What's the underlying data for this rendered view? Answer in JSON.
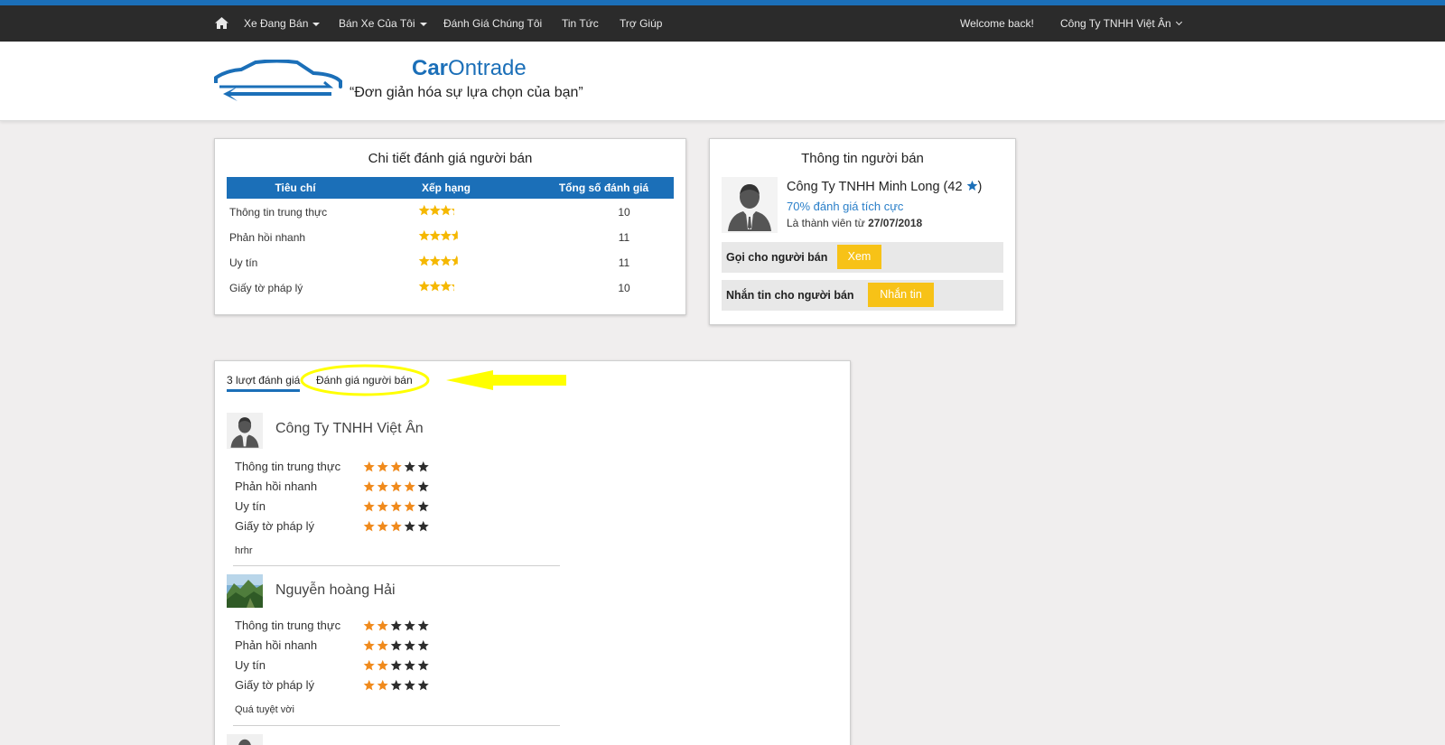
{
  "nav": {
    "items": [
      {
        "label": "Xe Đang Bán",
        "caret": true
      },
      {
        "label": "Bán Xe Của Tôi",
        "caret": true
      },
      {
        "label": "Đánh Giá Chúng Tôi",
        "caret": false
      },
      {
        "label": "Tin Tức",
        "caret": false
      },
      {
        "label": "Trợ Giúp",
        "caret": false
      }
    ],
    "welcome": "Welcome back!",
    "account": "Công Ty TNHH Việt Ân"
  },
  "header": {
    "brand_bold": "Car",
    "brand_rest": "Ontrade",
    "slogan": "“Đơn giản hóa sự lựa chọn của bạn”"
  },
  "ratings_panel": {
    "title": "Chi tiết đánh giá người bán",
    "columns": [
      "Tiêu chí",
      "Xếp hạng",
      "Tổng số đánh giá"
    ],
    "rows": [
      {
        "criterion": "Thông tin trung thực",
        "stars": 3.3,
        "count": "10"
      },
      {
        "criterion": "Phản hồi nhanh",
        "stars": 3.6,
        "count": "11"
      },
      {
        "criterion": "Uy tín",
        "stars": 3.6,
        "count": "11"
      },
      {
        "criterion": "Giấy tờ pháp lý",
        "stars": 3.3,
        "count": "10"
      }
    ]
  },
  "seller_panel": {
    "title": "Thông tin người bán",
    "name": "Công Ty TNHH Minh Long (42",
    "name_close": ")",
    "positive": "70% đánh giá tích cực",
    "member_prefix": "Là thành viên từ",
    "member_date": "27/07/2018",
    "call_label": "Gọi cho người bán",
    "call_button": "Xem",
    "message_label": "Nhắn tin cho người bán",
    "message_button": "Nhắn tin"
  },
  "reviews_panel": {
    "tabs": [
      "3 lượt đánh giá",
      "Đánh giá người bán"
    ],
    "reviews": [
      {
        "name": "Công Ty TNHH Việt Ân",
        "ratings": [
          {
            "criterion": "Thông tin trung thực",
            "stars": 3
          },
          {
            "criterion": "Phản hồi nhanh",
            "stars": 4
          },
          {
            "criterion": "Uy tín",
            "stars": 4
          },
          {
            "criterion": "Giấy tờ pháp lý",
            "stars": 3
          }
        ],
        "comment": "hrhr"
      },
      {
        "name": "Nguyễn hoàng Hải",
        "ratings": [
          {
            "criterion": "Thông tin trung thực",
            "stars": 2
          },
          {
            "criterion": "Phản hồi nhanh",
            "stars": 2
          },
          {
            "criterion": "Uy tín",
            "stars": 2
          },
          {
            "criterion": "Giấy tờ pháp lý",
            "stars": 2
          }
        ],
        "comment": "Quá tuyệt vời"
      }
    ]
  },
  "colors": {
    "primary_blue": "#1b6fb8",
    "nav_bg": "#2b2b2b",
    "button_yellow": "#f7c217",
    "star_gold": "#f5b800",
    "star_orange": "#f08a1c",
    "star_dark": "#2d2d2d",
    "annotation_yellow": "#ffff00"
  }
}
